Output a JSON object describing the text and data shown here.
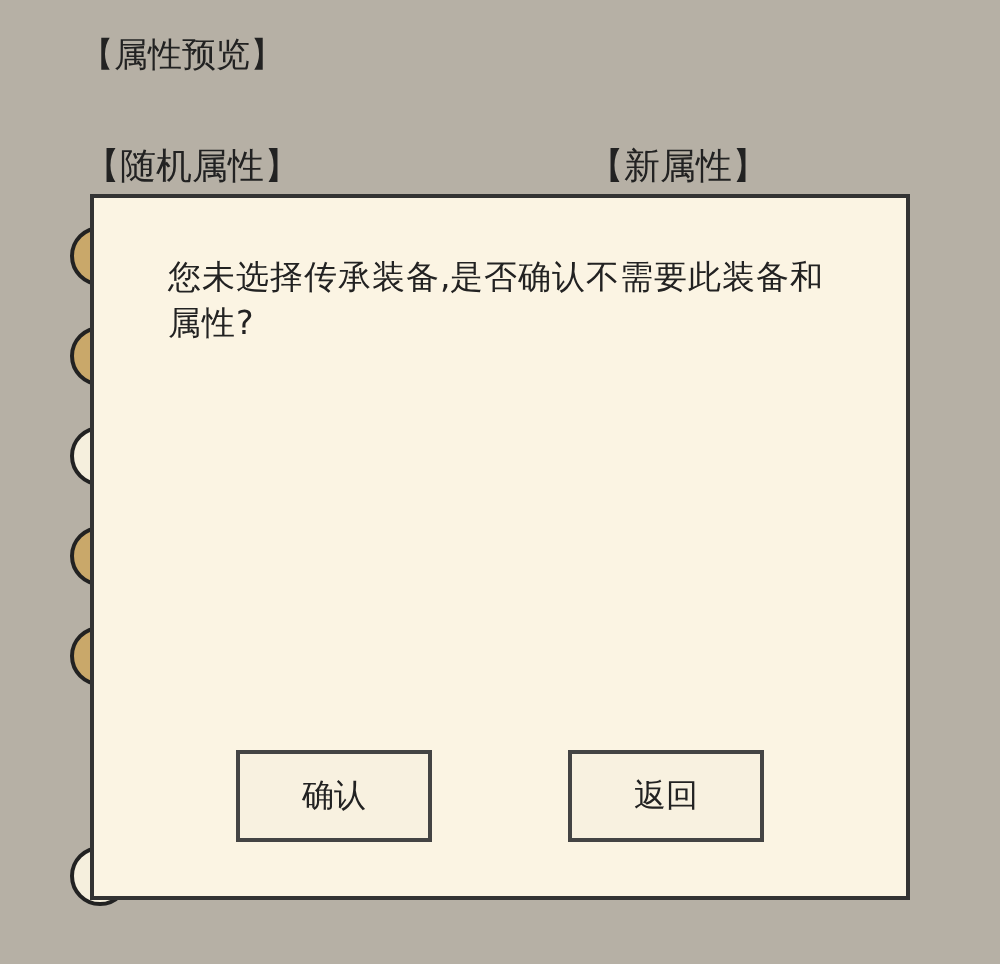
{
  "title": "【属性预览】",
  "columns": [
    {
      "label": "【随机属性】"
    },
    {
      "label": "【新属性】"
    }
  ],
  "slots": [
    {
      "kind": "filled"
    },
    {
      "kind": "filled"
    },
    {
      "kind": "empty"
    },
    {
      "kind": "filled"
    },
    {
      "kind": "filled"
    },
    {
      "kind": "empty"
    }
  ],
  "dialog": {
    "message": "您未选择传承装备,是否确认不需要此装备和属性?",
    "buttons": [
      "确认",
      "返回"
    ]
  }
}
